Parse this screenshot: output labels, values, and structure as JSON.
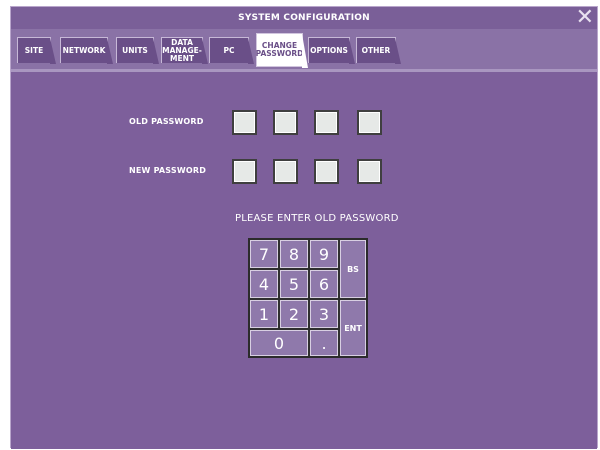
{
  "window": {
    "title": "SYSTEM CONFIGURATION",
    "close_glyph": "✕"
  },
  "tabs": [
    {
      "label": "SITE"
    },
    {
      "label": "NETWORK"
    },
    {
      "label": "UNITS"
    },
    {
      "label": "DATA MANAGE- MENT"
    },
    {
      "label": "PC"
    },
    {
      "label": "CHANGE PASSWORD",
      "active": true
    },
    {
      "label": "OPTIONS"
    },
    {
      "label": "OTHER"
    }
  ],
  "form": {
    "old_password_label": "OLD PASSWORD",
    "new_password_label": "NEW PASSWORD",
    "prompt": "PLEASE ENTER OLD PASSWORD"
  },
  "keypad": {
    "keys": [
      "7",
      "8",
      "9",
      "4",
      "5",
      "6",
      "1",
      "2",
      "3",
      "0",
      "."
    ],
    "bs_label": "BS",
    "ent_label": "ENT"
  },
  "colors": {
    "background": "#7d5f9b",
    "tab": "#6a4f88",
    "active_tab": "#ffffff",
    "key": "#8f79ab",
    "input_box": "#e6e9e7"
  },
  "icons": {
    "close": "close-icon"
  }
}
